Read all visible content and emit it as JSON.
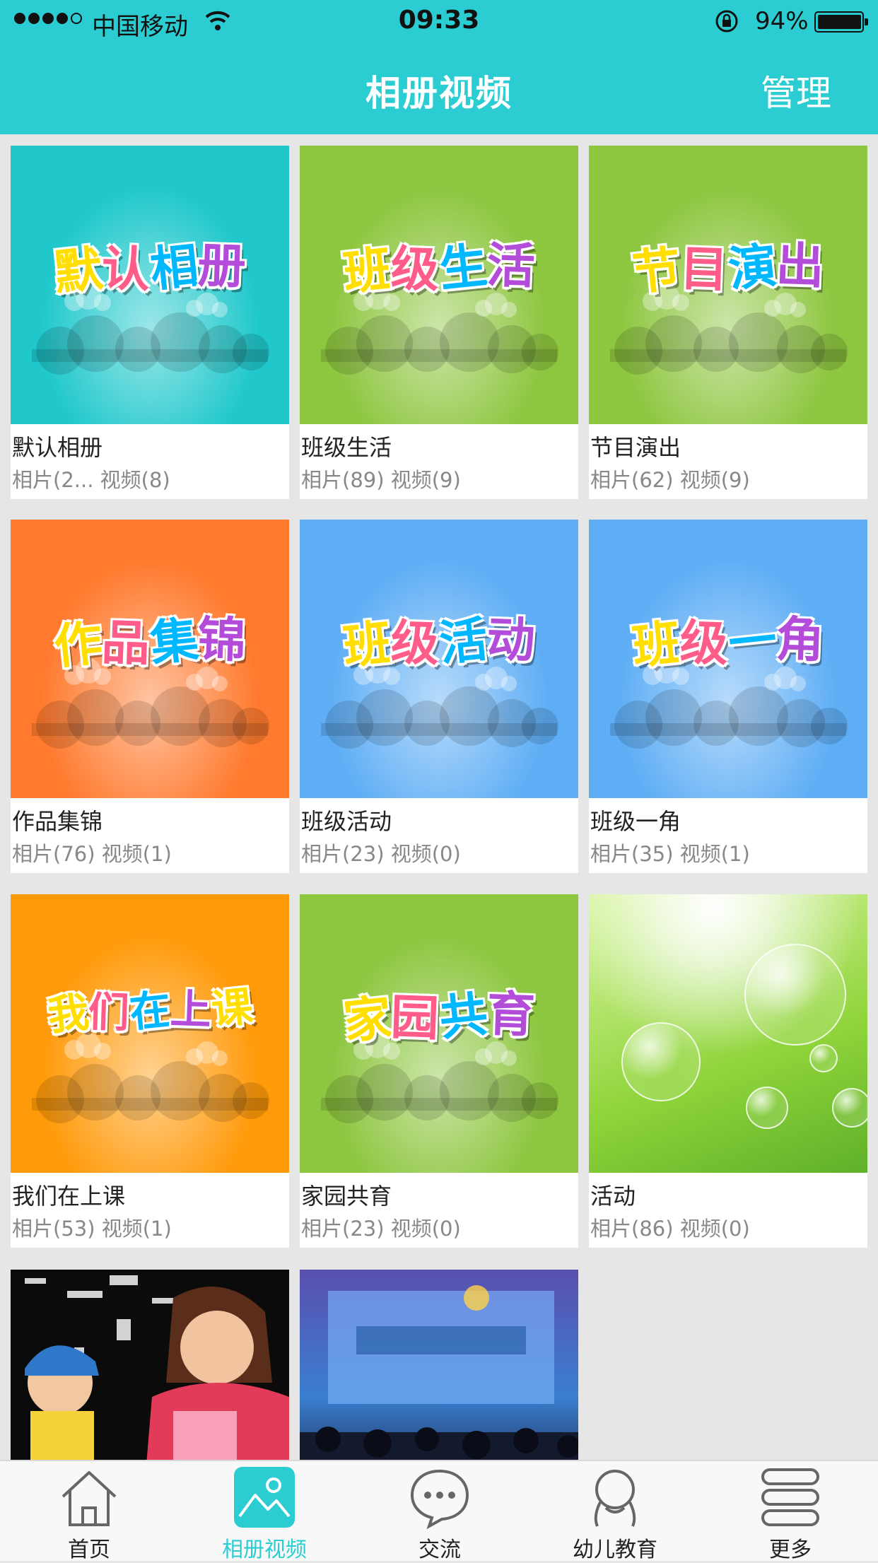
{
  "status_bar": {
    "carrier": "中国移动",
    "time": "09:33",
    "battery": "94%"
  },
  "nav": {
    "title": "相册视频",
    "manage": "管理"
  },
  "albums": [
    {
      "name": "默认相册",
      "counts": "相片(2...  视频(8)",
      "cover_text": "默认相册",
      "bg": "#20c8cc"
    },
    {
      "name": "班级生活",
      "counts": "相片(89) 视频(9)",
      "cover_text": "班级生活",
      "bg": "#8dc63f"
    },
    {
      "name": "节目演出",
      "counts": "相片(62) 视频(9)",
      "cover_text": "节目演出",
      "bg": "#8dc63f"
    },
    {
      "name": "作品集锦",
      "counts": "相片(76) 视频(1)",
      "cover_text": "作品集锦",
      "bg": "#ff7a2e"
    },
    {
      "name": "班级活动",
      "counts": "相片(23) 视频(0)",
      "cover_text": "班级活动",
      "bg": "#5faef5"
    },
    {
      "name": "班级一角",
      "counts": "相片(35) 视频(1)",
      "cover_text": "班级一角",
      "bg": "#5faef5"
    },
    {
      "name": "我们在上课",
      "counts": "相片(53) 视频(1)",
      "cover_text": "我们在上课",
      "bg": "#ff9a0a"
    },
    {
      "name": "家园共育",
      "counts": "相片(23) 视频(0)",
      "cover_text": "家园共育",
      "bg": "#8dc63f"
    },
    {
      "name": "活动",
      "counts": "相片(86) 视频(0)",
      "cover_text": "",
      "bg": "#a8e05a"
    }
  ],
  "tabs": [
    {
      "label": "首页",
      "icon": "home-icon"
    },
    {
      "label": "相册视频",
      "icon": "album-icon"
    },
    {
      "label": "交流",
      "icon": "chat-icon"
    },
    {
      "label": "幼儿教育",
      "icon": "child-icon"
    },
    {
      "label": "更多",
      "icon": "more-icon"
    }
  ],
  "colors": {
    "accent": "#2ccdd2",
    "cover_letters": [
      "#ffde00",
      "#ff5c8a",
      "#00b8ff",
      "#b34cd9"
    ]
  }
}
